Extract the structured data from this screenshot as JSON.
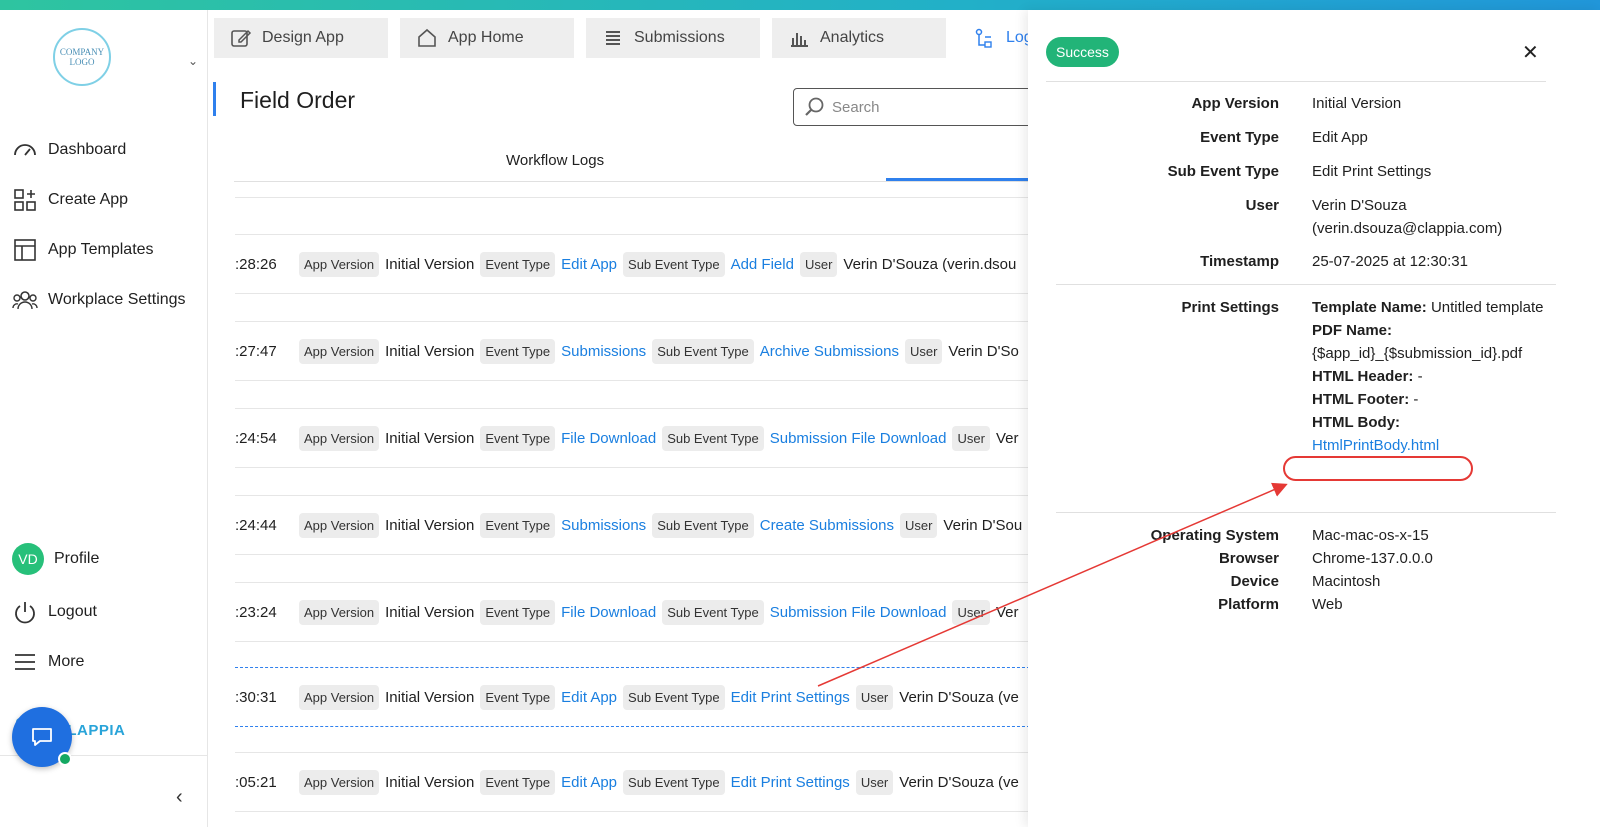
{
  "sidebar": {
    "logo_text": "COMPANY LOGO",
    "items": [
      {
        "label": "Dashboard"
      },
      {
        "label": "Create App"
      },
      {
        "label": "App Templates"
      },
      {
        "label": "Workplace Settings"
      }
    ],
    "profile": {
      "initials": "VD",
      "label": "Profile"
    },
    "logout": "Logout",
    "more": "More",
    "brand": "CLAPPIA"
  },
  "tabs": [
    {
      "label": "Design App",
      "icon": "edit-icon"
    },
    {
      "label": "App Home",
      "icon": "home-icon"
    },
    {
      "label": "Submissions",
      "icon": "list-icon"
    },
    {
      "label": "Analytics",
      "icon": "bar-chart-icon"
    },
    {
      "label": "Log",
      "icon": "workflow-icon"
    }
  ],
  "page": {
    "title": "Field Order",
    "search_placeholder": "Search",
    "subtab": "Workflow Logs"
  },
  "logs": [
    {
      "time": ":28:26",
      "version": "Initial Version",
      "event": "Edit App",
      "sub_event": "Add Field",
      "user": "Verin D'Souza (verin.dsou"
    },
    {
      "time": ":27:47",
      "version": "Initial Version",
      "event": "Submissions",
      "sub_event": "Archive Submissions",
      "user": "Verin D'So"
    },
    {
      "time": ":24:54",
      "version": "Initial Version",
      "event": "File Download",
      "sub_event": "Submission File Download",
      "user": "Ver"
    },
    {
      "time": ":24:44",
      "version": "Initial Version",
      "event": "Submissions",
      "sub_event": "Create Submissions",
      "user": "Verin D'Sou"
    },
    {
      "time": ":23:24",
      "version": "Initial Version",
      "event": "File Download",
      "sub_event": "Submission File Download",
      "user": "Ver"
    },
    {
      "time": ":30:31",
      "version": "Initial Version",
      "event": "Edit App",
      "sub_event": "Edit Print Settings",
      "user": "Verin D'Souza (ve"
    },
    {
      "time": ":05:21",
      "version": "Initial Version",
      "event": "Edit App",
      "sub_event": "Edit Print Settings",
      "user": "Verin D'Souza (ve"
    }
  ],
  "chips": {
    "app_version": "App Version",
    "event_type": "Event Type",
    "sub_event_type": "Sub Event Type",
    "user": "User"
  },
  "detail": {
    "status": "Success",
    "app_version_label": "App Version",
    "app_version": "Initial Version",
    "event_type_label": "Event Type",
    "event_type": "Edit App",
    "sub_event_type_label": "Sub Event Type",
    "sub_event_type": "Edit Print Settings",
    "user_label": "User",
    "user_name": "Verin D'Souza",
    "user_email": "(verin.dsouza@clappia.com)",
    "timestamp_label": "Timestamp",
    "timestamp": "25-07-2025 at 12:30:31",
    "print_settings_label": "Print Settings",
    "template_name_key": "Template Name:",
    "template_name": "Untitled template",
    "pdf_name_key": "PDF Name:",
    "pdf_name": "{$app_id}_{$submission_id}.pdf",
    "html_header_key": "HTML Header:",
    "html_header": "-",
    "html_footer_key": "HTML Footer:",
    "html_footer": "-",
    "html_body_key": "HTML Body:",
    "html_body": "HtmlPrintBody.html",
    "os_label": "Operating System",
    "os": "Mac-mac-os-x-15",
    "browser_label": "Browser",
    "browser": "Chrome-137.0.0.0",
    "device_label": "Device",
    "device": "Macintosh",
    "platform_label": "Platform",
    "platform": "Web"
  },
  "colors": {
    "accent": "#2f80ed",
    "link": "#1a7fe0",
    "success": "#22b478",
    "annotation": "#e53935"
  }
}
